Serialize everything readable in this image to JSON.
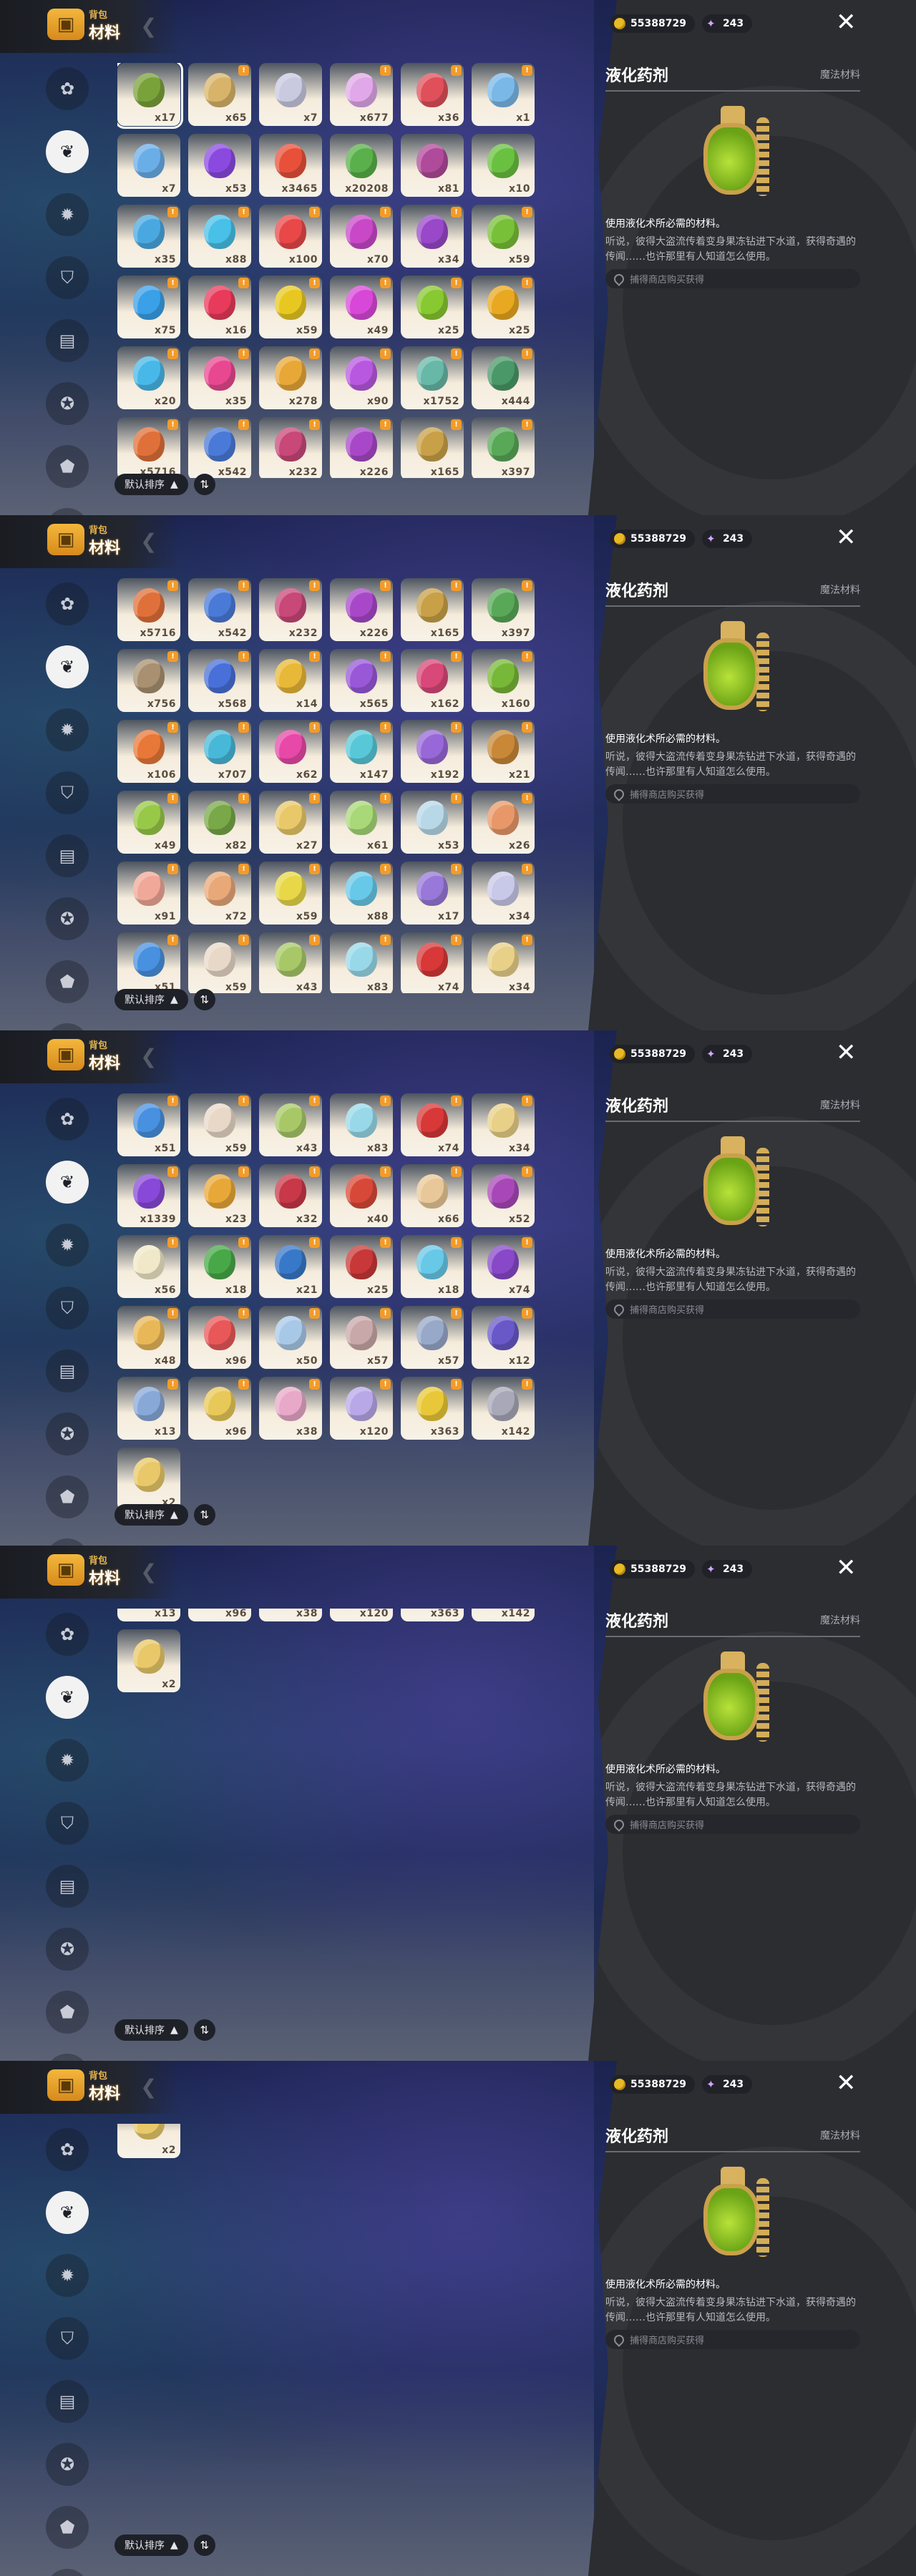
{
  "header": {
    "sub": "背包",
    "title": "材料"
  },
  "currency": {
    "coins": "55388729",
    "gems": "243"
  },
  "sort": {
    "label": "默认排序"
  },
  "detail": {
    "name": "液化药剂",
    "type": "魔法材料",
    "desc": "使用液化术所必需的材料。",
    "lore": "听说，彼得大盗流传着变身果冻钻进下水道，获得奇遇的传闻……也许那里有人知道怎么使用。",
    "source": "捕得商店购买获得"
  },
  "colors": {
    "accent": "#f29b2a",
    "panel": "#2c2d31"
  },
  "sidebar": [
    {
      "icon": "flower-icon"
    },
    {
      "icon": "leaf-icon"
    },
    {
      "icon": "gear-icon"
    },
    {
      "icon": "shield-icon"
    },
    {
      "icon": "scroll-icon"
    },
    {
      "icon": "star-icon"
    },
    {
      "icon": "acorn-icon"
    },
    {
      "icon": "face-icon"
    }
  ],
  "items": [
    {
      "count": "x17",
      "color": "#7aa23a",
      "badge": ""
    },
    {
      "count": "x65",
      "color": "#d8b46a",
      "badge": "!"
    },
    {
      "count": "x7",
      "color": "#c9c9e0",
      "badge": ""
    },
    {
      "count": "x677",
      "color": "#e0a8e8",
      "badge": "!"
    },
    {
      "count": "x36",
      "color": "#e0505a",
      "badge": "!"
    },
    {
      "count": "x1",
      "color": "#7ab8e8",
      "badge": "!"
    },
    {
      "count": "x7",
      "color": "#6aaee8",
      "badge": ""
    },
    {
      "count": "x53",
      "color": "#8a4ae0",
      "badge": ""
    },
    {
      "count": "x3465",
      "color": "#e8503a",
      "badge": ""
    },
    {
      "count": "x20208",
      "color": "#5ab04a",
      "badge": ""
    },
    {
      "count": "x81",
      "color": "#b04a9a",
      "badge": ""
    },
    {
      "count": "x10",
      "color": "#6ac040",
      "badge": ""
    },
    {
      "count": "x35",
      "color": "#4aa8e0",
      "badge": "!"
    },
    {
      "count": "x88",
      "color": "#48c0e8",
      "badge": "!"
    },
    {
      "count": "x100",
      "color": "#e84848",
      "badge": "!"
    },
    {
      "count": "x70",
      "color": "#c848c8",
      "badge": "!"
    },
    {
      "count": "x34",
      "color": "#9848c8",
      "badge": "!"
    },
    {
      "count": "x59",
      "color": "#78c038",
      "badge": "!"
    },
    {
      "count": "x75",
      "color": "#3aa0e8",
      "badge": "!"
    },
    {
      "count": "x16",
      "color": "#e83a5a",
      "badge": "!"
    },
    {
      "count": "x59",
      "color": "#e8c820",
      "badge": "!"
    },
    {
      "count": "x49",
      "color": "#d848d8",
      "badge": "!"
    },
    {
      "count": "x25",
      "color": "#88c830",
      "badge": "!"
    },
    {
      "count": "x25",
      "color": "#e8a820",
      "badge": "!"
    },
    {
      "count": "x20",
      "color": "#48b8e8",
      "badge": "!"
    },
    {
      "count": "x35",
      "color": "#e84890",
      "badge": "!"
    },
    {
      "count": "x278",
      "color": "#e8a838",
      "badge": "!"
    },
    {
      "count": "x90",
      "color": "#b858e0",
      "badge": "!"
    },
    {
      "count": "x1752",
      "color": "#68b8a8",
      "badge": "!"
    },
    {
      "count": "x444",
      "color": "#4a9868",
      "badge": "!"
    },
    {
      "count": "x5716",
      "color": "#e0703a",
      "badge": "!"
    },
    {
      "count": "x542",
      "color": "#4a7ad8",
      "badge": "!"
    },
    {
      "count": "x232",
      "color": "#c84878",
      "badge": "!"
    },
    {
      "count": "x226",
      "color": "#a848c8",
      "badge": "!"
    },
    {
      "count": "x165",
      "color": "#c8a048",
      "badge": "!"
    },
    {
      "count": "x397",
      "color": "#58a858",
      "badge": "!"
    },
    {
      "count": "x756",
      "color": "#a89070",
      "badge": "!"
    },
    {
      "count": "x568",
      "color": "#4870d8",
      "badge": "!"
    },
    {
      "count": "x14",
      "color": "#e8b838",
      "badge": "!"
    },
    {
      "count": "x565",
      "color": "#9858d8",
      "badge": "!"
    },
    {
      "count": "x162",
      "color": "#d84878",
      "badge": "!"
    },
    {
      "count": "x160",
      "color": "#78b838",
      "badge": "!"
    },
    {
      "count": "x106",
      "color": "#e87838",
      "badge": "!"
    },
    {
      "count": "x707",
      "color": "#48b8d8",
      "badge": "!"
    },
    {
      "count": "x62",
      "color": "#e848a8",
      "badge": "!"
    },
    {
      "count": "x147",
      "color": "#58c8d8",
      "badge": "!"
    },
    {
      "count": "x192",
      "color": "#9868d8",
      "badge": "!"
    },
    {
      "count": "x21",
      "color": "#c88838",
      "badge": "!"
    },
    {
      "count": "x49",
      "color": "#98c848",
      "badge": "!"
    },
    {
      "count": "x82",
      "color": "#78a848",
      "badge": "!"
    },
    {
      "count": "x27",
      "color": "#e8c868",
      "badge": "!"
    },
    {
      "count": "x61",
      "color": "#a8d878",
      "badge": "!"
    },
    {
      "count": "x53",
      "color": "#b8d8e8",
      "badge": "!"
    },
    {
      "count": "x26",
      "color": "#e89868",
      "badge": "!"
    },
    {
      "count": "x91",
      "color": "#f0a898",
      "badge": "!"
    },
    {
      "count": "x72",
      "color": "#e8a878",
      "badge": "!"
    },
    {
      "count": "x59",
      "color": "#e8d848",
      "badge": "!"
    },
    {
      "count": "x88",
      "color": "#68c8e8",
      "badge": "!"
    },
    {
      "count": "x17",
      "color": "#9878d8",
      "badge": "!"
    },
    {
      "count": "x34",
      "color": "#c8c8e8",
      "badge": "!"
    },
    {
      "count": "x51",
      "color": "#4890e0",
      "badge": "!"
    },
    {
      "count": "x59",
      "color": "#e8d8c8",
      "badge": "!"
    },
    {
      "count": "x43",
      "color": "#a8c868",
      "badge": "!"
    },
    {
      "count": "x83",
      "color": "#98d8e8",
      "badge": "!"
    },
    {
      "count": "x74",
      "color": "#d83838",
      "badge": "!"
    },
    {
      "count": "x34",
      "color": "#e8d088",
      "badge": "!"
    },
    {
      "count": "x1339",
      "color": "#8848d8",
      "badge": "!"
    },
    {
      "count": "x23",
      "color": "#e8a838",
      "badge": "!"
    },
    {
      "count": "x32",
      "color": "#c83848",
      "badge": "!"
    },
    {
      "count": "x40",
      "color": "#d84838",
      "badge": "!"
    },
    {
      "count": "x66",
      "color": "#e8c898",
      "badge": "!"
    },
    {
      "count": "x52",
      "color": "#a848b8",
      "badge": "!"
    },
    {
      "count": "x56",
      "color": "#f0e8c8",
      "badge": "!"
    },
    {
      "count": "x18",
      "color": "#48a848",
      "badge": "!"
    },
    {
      "count": "x21",
      "color": "#3878c8",
      "badge": "!"
    },
    {
      "count": "x25",
      "color": "#c83838",
      "badge": "!"
    },
    {
      "count": "x18",
      "color": "#68c8e8",
      "badge": "!"
    },
    {
      "count": "x74",
      "color": "#8848c8",
      "badge": "!"
    },
    {
      "count": "x48",
      "color": "#e8b858",
      "badge": "!"
    },
    {
      "count": "x96",
      "color": "#e85858",
      "badge": "!"
    },
    {
      "count": "x50",
      "color": "#a8c8e8",
      "badge": "!"
    },
    {
      "count": "x57",
      "color": "#c8a8a8",
      "badge": "!"
    },
    {
      "count": "x57",
      "color": "#98a8c8",
      "badge": "!"
    },
    {
      "count": "x12",
      "color": "#6858c8",
      "badge": "!"
    },
    {
      "count": "x13",
      "color": "#88a8d8",
      "badge": "!"
    },
    {
      "count": "x96",
      "color": "#e8c858",
      "badge": "!"
    },
    {
      "count": "x38",
      "color": "#e8a8c8",
      "badge": "!"
    },
    {
      "count": "x120",
      "color": "#b8a8e8",
      "badge": "!"
    },
    {
      "count": "x363",
      "color": "#e8c838",
      "badge": "!"
    },
    {
      "count": "x142",
      "color": "#a8a8b8",
      "badge": "!"
    },
    {
      "count": "x2",
      "color": "#e8c868",
      "badge": ""
    }
  ],
  "frames": [
    {
      "offset": 0,
      "activeTab": 1
    },
    {
      "offset": 30,
      "activeTab": 1
    },
    {
      "offset": 60,
      "activeTab": 1
    },
    {
      "offset": 84,
      "activeTab": 1
    },
    {
      "offset": 90,
      "activeTab": 1
    }
  ]
}
